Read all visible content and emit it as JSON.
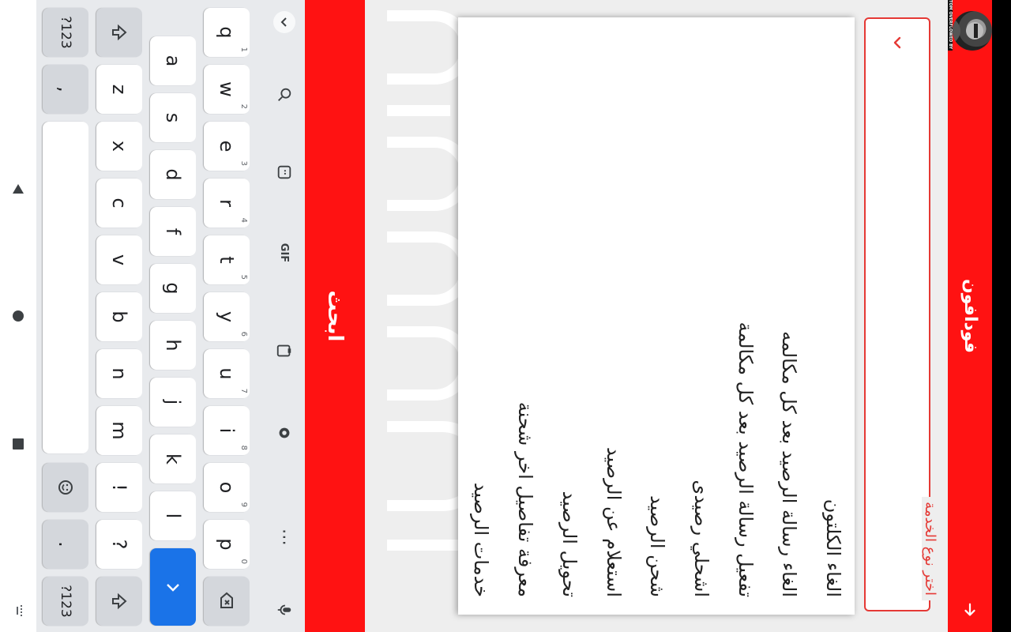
{
  "app": {
    "title": "فودافون",
    "status_overflow_text": "TOM OVERFLOWED BY 11 PIXELS"
  },
  "dropdown": {
    "label": "اختر نوع الخدمة"
  },
  "menu": {
    "items": [
      "الغاء الكلتون",
      "الغاء رسالة الرصيد بعد كل مكالمه",
      "تفعيل رسالة الرصيد بعد كل مكالمة",
      "اشحلي رصيدى",
      "شحن الرصيد",
      "استعلام عن الرصيد",
      "تحويل الرصيد",
      "معرفة تفاصيل اخر شحنة",
      "خدمات الرصيد"
    ]
  },
  "search_button": {
    "label": "ابحث"
  },
  "keyboard": {
    "row1": [
      "q",
      "w",
      "e",
      "r",
      "t",
      "y",
      "u",
      "i",
      "o",
      "p"
    ],
    "row1_hints": [
      "1",
      "2",
      "3",
      "4",
      "5",
      "6",
      "7",
      "8",
      "9",
      "0"
    ],
    "row2": [
      "a",
      "s",
      "d",
      "f",
      "g",
      "h",
      "j",
      "k",
      "l"
    ],
    "row3": [
      "z",
      "x",
      "c",
      "v",
      "b",
      "n",
      "m",
      "!",
      "?"
    ],
    "symbols_label": "?123",
    "comma": ",",
    "period": ".",
    "toolbar_gif": "GIF"
  },
  "colors": {
    "brand_red": "#ff1212",
    "field_red": "#e53935",
    "enter_blue": "#1a73e8"
  }
}
